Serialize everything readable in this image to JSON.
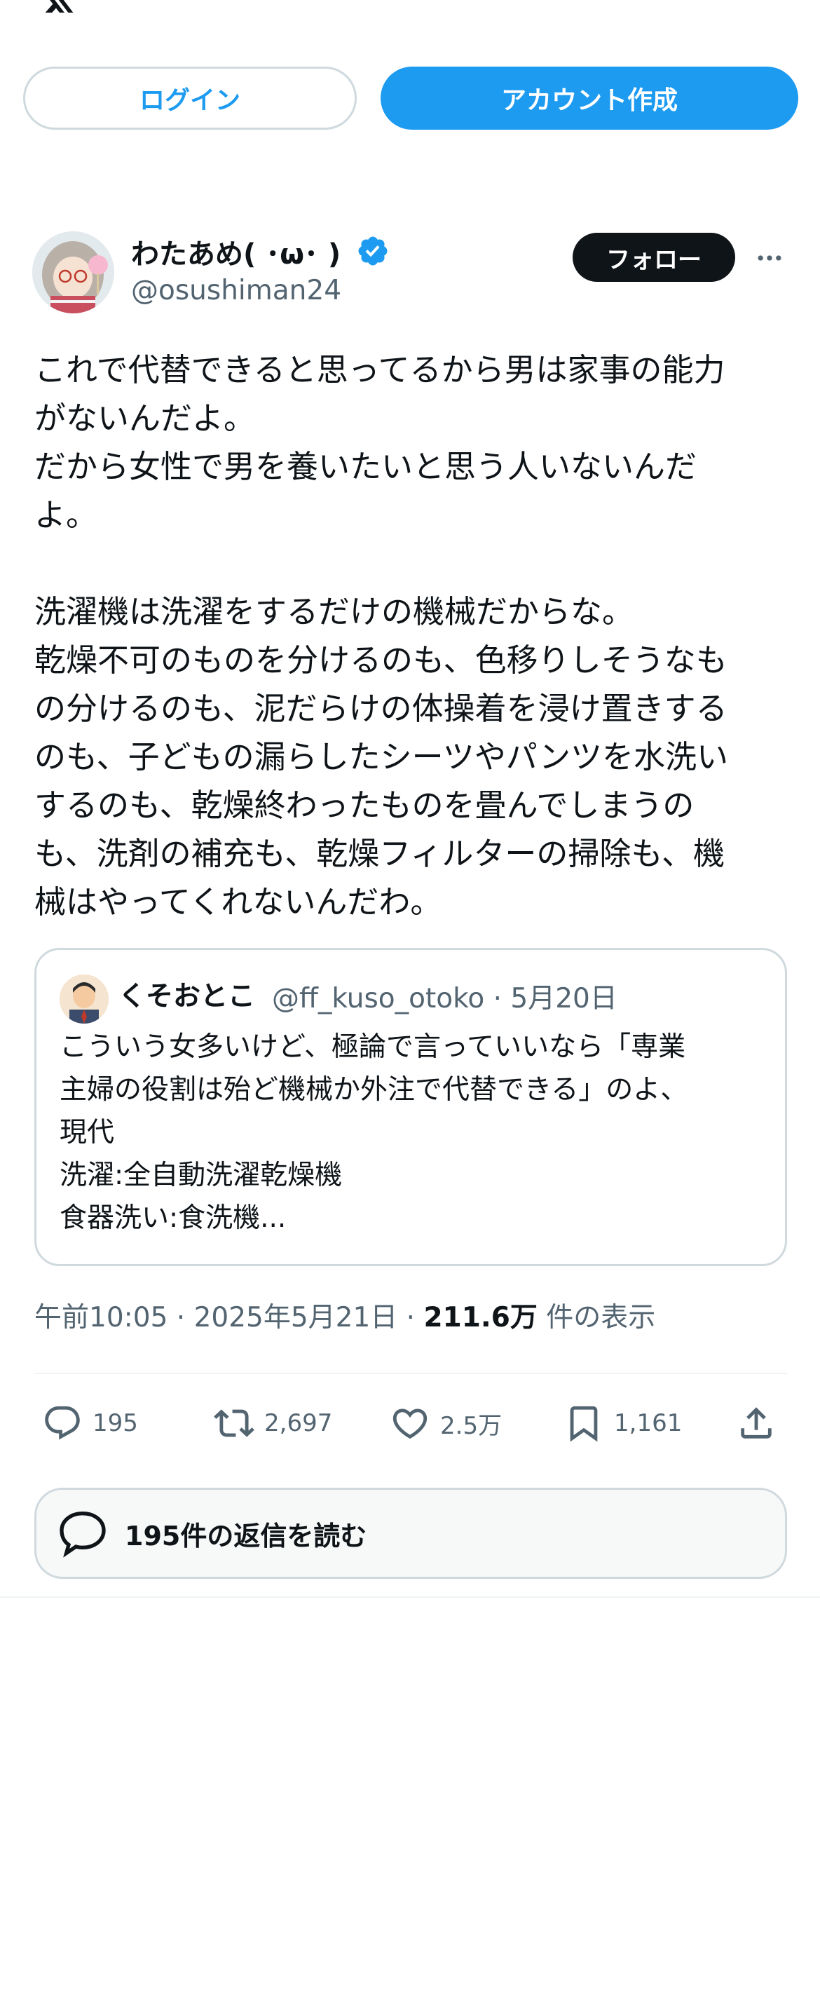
{
  "header": {
    "logo_icon": "x-logo-icon",
    "login_label": "ログイン",
    "signup_label": "アカウント作成"
  },
  "tweet": {
    "author_name": "わたあめ( ･ω･ )",
    "author_handle": "@osushiman24",
    "verified": true,
    "follow_label": "フォロー",
    "more_icon": "more-dots-icon",
    "lines": [
      "これで代替できると思ってるから男は家事の能力",
      "がないんだよ。",
      "だから女性で男を養いたいと思う人いないんだ",
      "よ。",
      "",
      "洗濯機は洗濯をするだけの機械だからな。",
      "乾燥不可のものを分けるのも、色移りしそうなも",
      "の分けるのも、泥だらけの体操着を浸け置きする",
      "のも、子どもの漏らしたシーツやパンツを水洗い",
      "するのも、乾燥終わったものを畳んでしまうの",
      "も、洗剤の補充も、乾燥フィルターの掃除も、機",
      "械はやってくれないんだわ。"
    ],
    "quote": {
      "author_name": "くそおとこ",
      "author_handle": "@ff_kuso_otoko · 5月20日",
      "lines": [
        "こういう女多いけど、極論で言っていいなら「専業",
        "主婦の役割は殆ど機械か外注で代替できる」のよ、",
        "現代",
        "洗濯:全自動洗濯乾燥機",
        "食器洗い:食洗機..."
      ]
    },
    "meta": {
      "time": "午前10:05 · 2025年5月21日 · ",
      "views": "211.6万",
      "views_label": " 件の表示"
    },
    "actions": {
      "replies": "195",
      "retweets": "2,697",
      "likes": "2.5万",
      "bookmarks": "1,161"
    },
    "read_replies_label": "195件の返信を読む"
  },
  "colors": {
    "accent": "#1d9bf0",
    "text": "#0f1419",
    "secondary": "#536471",
    "border": "#cfd9de"
  }
}
